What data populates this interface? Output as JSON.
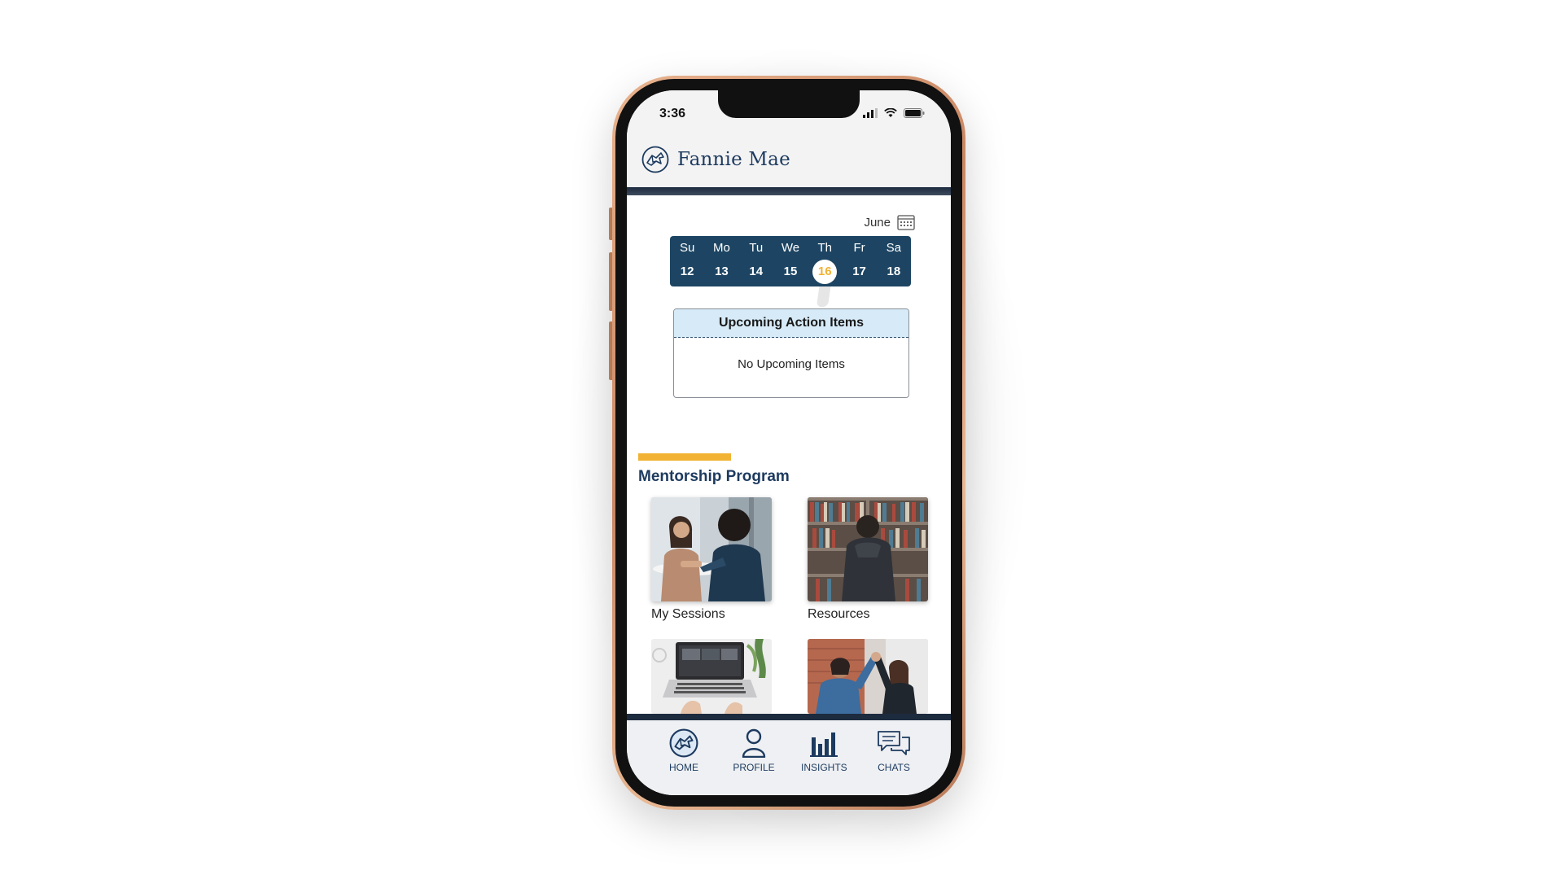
{
  "status_bar": {
    "time": "3:36"
  },
  "header": {
    "brand_name": "Fannie Mae"
  },
  "calendar": {
    "month": "June",
    "days": [
      {
        "name": "Su",
        "num": "12"
      },
      {
        "name": "Mo",
        "num": "13"
      },
      {
        "name": "Tu",
        "num": "14"
      },
      {
        "name": "We",
        "num": "15"
      },
      {
        "name": "Th",
        "num": "16"
      },
      {
        "name": "Fr",
        "num": "17"
      },
      {
        "name": "Sa",
        "num": "18"
      }
    ],
    "selected_day": "16"
  },
  "upcoming": {
    "title": "Upcoming Action Items",
    "empty_text": "No Upcoming Items"
  },
  "mentorship": {
    "title": "Mentorship Program",
    "tiles": [
      {
        "label": "My Sessions"
      },
      {
        "label": "Resources"
      }
    ]
  },
  "nav": {
    "items": [
      {
        "label": "HOME",
        "icon": "fannie-mae-logo-icon"
      },
      {
        "label": "PROFILE",
        "icon": "user-icon"
      },
      {
        "label": "INSIGHTS",
        "icon": "bar-chart-icon"
      },
      {
        "label": "CHATS",
        "icon": "chat-bubbles-icon"
      }
    ]
  },
  "colors": {
    "navy": "#1d3a5f",
    "calendar_bg": "#1d4563",
    "accent_gold": "#f2b233",
    "card_header": "#d6eaf7"
  }
}
